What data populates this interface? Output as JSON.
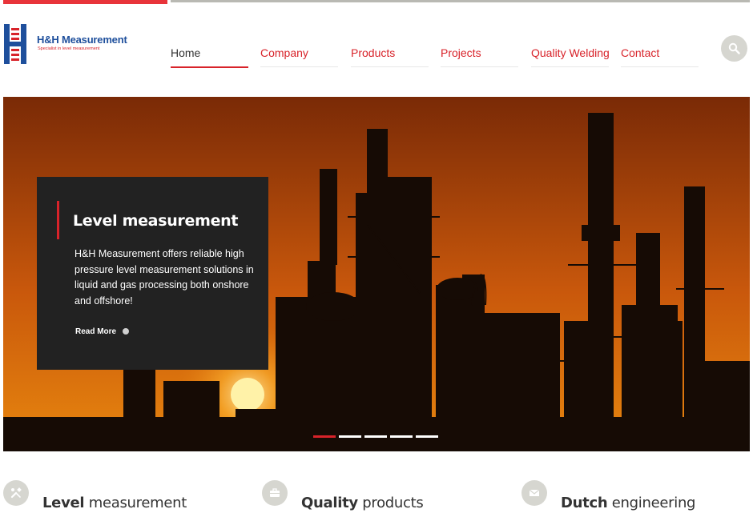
{
  "brand": {
    "name": "H&H Measurement",
    "tagline": "Specialist in level measurement",
    "primary_color": "#1e4f9c",
    "accent_color": "#d8232a"
  },
  "nav": {
    "items": [
      {
        "label": "Home"
      },
      {
        "label": "Company"
      },
      {
        "label": "Products"
      },
      {
        "label": "Projects"
      },
      {
        "label": "Quality Welding"
      },
      {
        "label": "Contact"
      }
    ],
    "active_label": "Home",
    "active_color": "#333333",
    "link_color": "#d8232a"
  },
  "search": {
    "icon": "search-icon"
  },
  "hero": {
    "slide": {
      "title": "Level measurement",
      "text": "H&H Measurement offers reliable high pressure level measurement solutions in liquid and gas processing both onshore and offshore!",
      "link_label": "Read More"
    },
    "slide_count": 5,
    "active_slide": 1
  },
  "features": [
    {
      "bold": "Level",
      "rest": " measurement",
      "icon": "tools-icon"
    },
    {
      "bold": "Quality",
      "rest": " products",
      "icon": "briefcase-icon"
    },
    {
      "bold": "Dutch",
      "rest": " engineering",
      "icon": "envelope-icon"
    }
  ],
  "colors": {
    "topbar_red": "#e8343a",
    "topbar_grey": "#b9b9b3",
    "sky_top": "#7a2a06",
    "sky_mid": "#c9580c",
    "sky_glow": "#e8870e",
    "sun": "#fff2a8"
  }
}
